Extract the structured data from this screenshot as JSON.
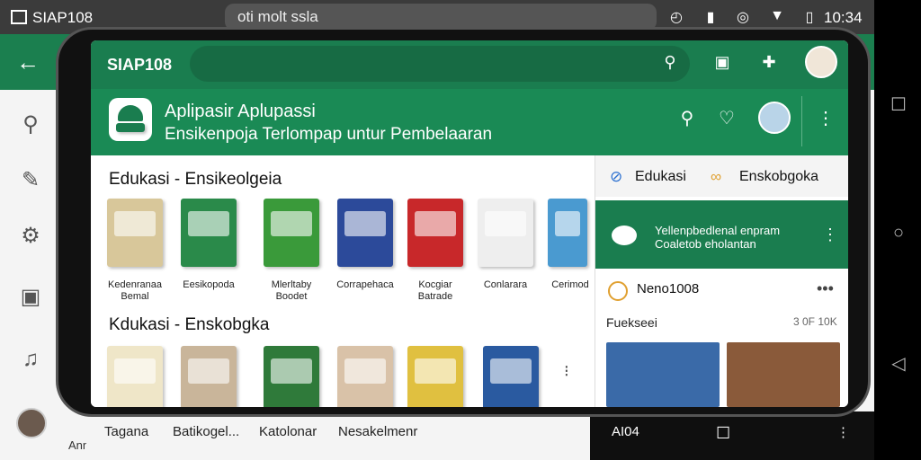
{
  "statusbar": {
    "title": "SIAP108",
    "search_text": "oti molt ssla",
    "time": "10:34",
    "icons": [
      "alarm-icon",
      "battery-saver-icon",
      "sync-icon",
      "wifi-icon",
      "battery-icon"
    ]
  },
  "background_app": {
    "rail_icons": [
      "search-icon",
      "brush-icon",
      "gear-icon",
      "gallery-icon",
      "music-icon"
    ],
    "footer_label": "Ann",
    "bottom_tabs": [
      "Tagana",
      "Batikogel...",
      "Katolonar",
      "Nesakelmenr"
    ]
  },
  "phone": {
    "topbar": {
      "title": "SIAP108",
      "icons": [
        "search-icon",
        "download-icon",
        "puzzle-icon"
      ]
    },
    "header": {
      "title": "Aplipasir Aplupassi",
      "subtitle": "Ensikenpoja Terlompap untur Pembelaaran",
      "icons": [
        "search-icon",
        "heart-icon",
        "more-vert-icon"
      ]
    },
    "sections": [
      {
        "title": "Edukasi - Ensikeolgeia",
        "captions": [
          "Kedenranaa Bemal",
          "Eesikopoda",
          "Mlerltaby Boodet",
          "Corrapehaca",
          "Kocgiar Batrade",
          "Conlarara",
          "Cerimod"
        ]
      },
      {
        "title": "Kdukasi - Enskobgka",
        "captions": []
      }
    ],
    "side": {
      "tabs": [
        {
          "label": "Edukasi",
          "icon": "compass-icon"
        },
        {
          "label": "Enskobgoka",
          "icon": "infinity-icon"
        }
      ],
      "banner_line1": "Yellenpbedlenal enpram",
      "banner_line2": "Coaletob eholantan",
      "post_title": "Neno1008",
      "row_left": "Fuekseei",
      "row_right": "3 0F 10K"
    },
    "bottom_left": "AI04"
  },
  "colors": {
    "primary": "#1a7d4f",
    "header": "#1a8a55",
    "accent": "#e0a030"
  }
}
